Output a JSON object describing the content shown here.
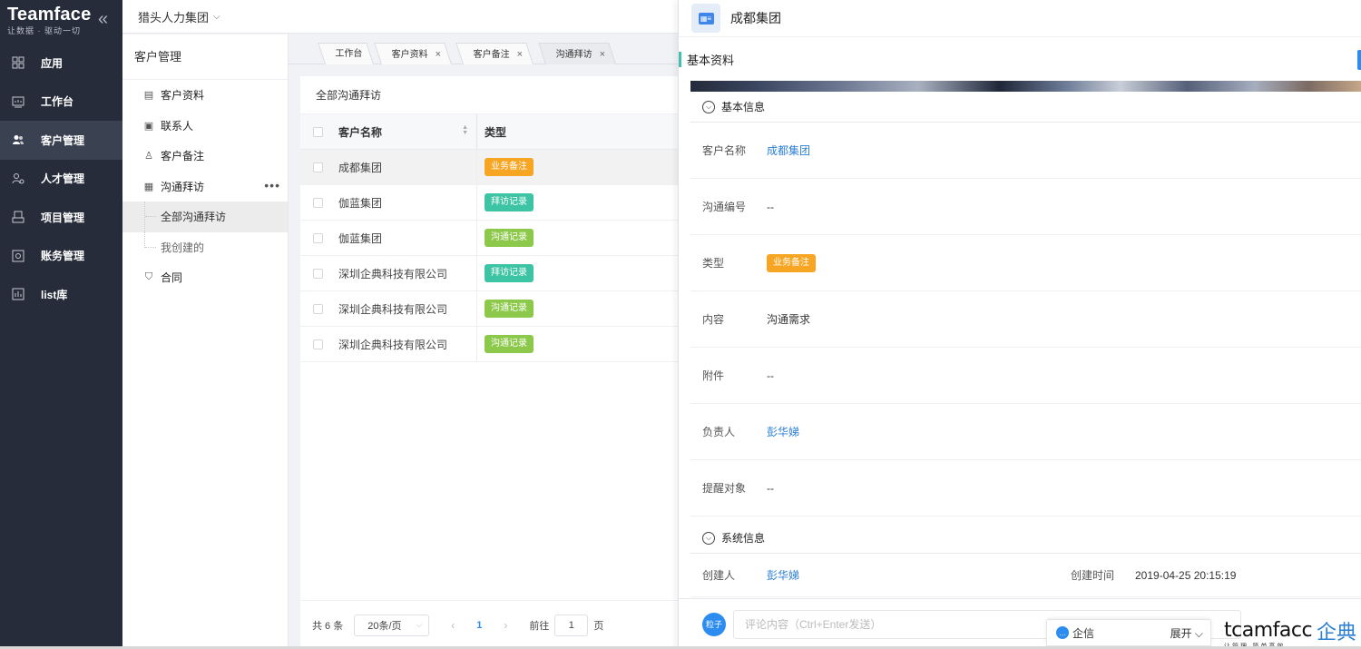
{
  "brand": {
    "name": "Teamface",
    "slogan": "让数据 · 驱动一切",
    "collapse": "«"
  },
  "nav": [
    {
      "label": "应用",
      "icon": "grid-icon"
    },
    {
      "label": "工作台",
      "icon": "dashboard-icon"
    },
    {
      "label": "客户管理",
      "icon": "users-icon"
    },
    {
      "label": "人才管理",
      "icon": "talent-icon"
    },
    {
      "label": "项目管理",
      "icon": "project-icon"
    },
    {
      "label": "账务管理",
      "icon": "finance-icon"
    },
    {
      "label": "list库",
      "icon": "list-icon"
    }
  ],
  "topbar": {
    "org": "猎头人力集团",
    "caret": "⌵"
  },
  "subnav": {
    "title": "客户管理",
    "items": [
      {
        "label": "客户资料",
        "icon": "▤"
      },
      {
        "label": "联系人",
        "icon": "▣"
      },
      {
        "label": "客户备注",
        "icon": "♙"
      },
      {
        "label": "沟通拜访",
        "icon": "▦",
        "more": "•••"
      }
    ],
    "children": [
      "全部沟通拜访",
      "我创建的"
    ],
    "contract": {
      "label": "合同",
      "icon": "⛉"
    }
  },
  "tabs": [
    {
      "label": "工作台",
      "close": ""
    },
    {
      "label": "客户资料",
      "close": "×"
    },
    {
      "label": "客户备注",
      "close": "×"
    },
    {
      "label": "沟通拜访",
      "close": "×"
    }
  ],
  "table": {
    "title": "全部沟通拜访",
    "col_name": "客户名称",
    "col_type": "类型",
    "rows": [
      {
        "name": "成都集团",
        "type": "业务备注",
        "color": "#f6a623"
      },
      {
        "name": "伽蓝集团",
        "type": "拜访记录",
        "color": "#3cc4a4"
      },
      {
        "name": "伽蓝集团",
        "type": "沟通记录",
        "color": "#8cc94a"
      },
      {
        "name": "深圳企典科技有限公司",
        "type": "拜访记录",
        "color": "#3cc4a4"
      },
      {
        "name": "深圳企典科技有限公司",
        "type": "沟通记录",
        "color": "#8cc94a"
      },
      {
        "name": "深圳企典科技有限公司",
        "type": "沟通记录",
        "color": "#8cc94a"
      }
    ]
  },
  "pager": {
    "total": "共 6 条",
    "per_page": "20条/页",
    "prev": "‹",
    "page": "1",
    "next": "›",
    "goto": "前往",
    "goto_value": "1",
    "page_unit": "页"
  },
  "detail": {
    "title": "成都集团",
    "section_basic_tab": "基本资料",
    "section_basic": "基本信息",
    "fields": [
      {
        "label": "客户名称",
        "value": "成都集团",
        "kind": "link"
      },
      {
        "label": "沟通编号",
        "value": "--",
        "kind": "text"
      },
      {
        "label": "类型",
        "value": "业务备注",
        "kind": "tag",
        "color": "#f6a623"
      },
      {
        "label": "内容",
        "value": "沟通需求",
        "kind": "text"
      },
      {
        "label": "附件",
        "value": "--",
        "kind": "text"
      },
      {
        "label": "负责人",
        "value": "彭华娣",
        "kind": "link"
      },
      {
        "label": "提醒对象",
        "value": "--",
        "kind": "text"
      }
    ],
    "section_system": "系统信息",
    "creator_label": "创建人",
    "creator": "彭华娣",
    "created_label": "创建时间",
    "created": "2019-04-25 20:15:19",
    "comment_avatar": "粒子",
    "comment_placeholder": "评论内容（Ctrl+Enter发送）"
  },
  "chat": {
    "label": "企信",
    "expand": "展开 ⌵"
  },
  "watermark": {
    "en": "tcamfacc",
    "cn": "企典",
    "sub": "让管理·简单高效"
  }
}
